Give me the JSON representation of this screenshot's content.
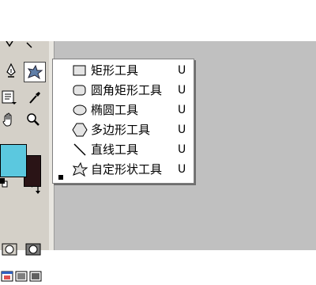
{
  "shape_menu": {
    "items": [
      {
        "label": "矩形工具",
        "shortcut": "U",
        "icon": "rectangle-icon",
        "checked": false
      },
      {
        "label": "圆角矩形工具",
        "shortcut": "U",
        "icon": "rounded-rectangle-icon",
        "checked": false
      },
      {
        "label": "椭圆工具",
        "shortcut": "U",
        "icon": "ellipse-icon",
        "checked": false
      },
      {
        "label": "多边形工具",
        "shortcut": "U",
        "icon": "polygon-icon",
        "checked": false
      },
      {
        "label": "直线工具",
        "shortcut": "U",
        "icon": "line-icon",
        "checked": false
      },
      {
        "label": "自定形状工具",
        "shortcut": "U",
        "icon": "custom-shape-icon",
        "checked": true
      }
    ]
  },
  "colors": {
    "foreground": "#5bc8df",
    "background": "#2a1416",
    "workspace": "#c0c0c0"
  }
}
